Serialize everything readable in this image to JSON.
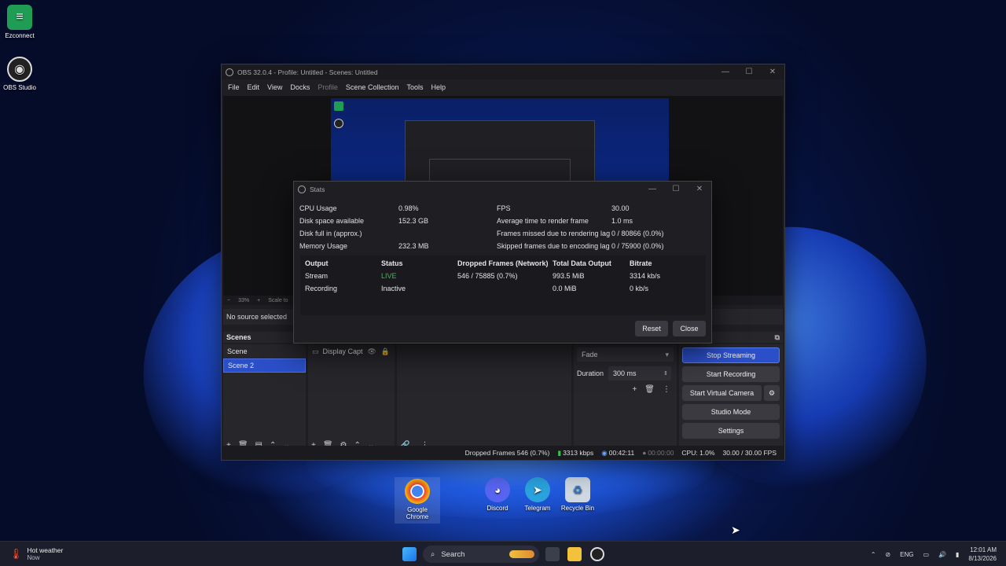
{
  "desktop": {
    "icons": [
      {
        "label": "Ezconnect",
        "icon": "ezconnect-icon"
      },
      {
        "label": "OBS Studio",
        "icon": "obs-icon"
      }
    ],
    "bottom_icons": [
      {
        "label": "Google Chrome",
        "icon": "chrome-icon"
      },
      {
        "label": "Discord",
        "icon": "discord-icon"
      },
      {
        "label": "Telegram",
        "icon": "telegram-icon"
      },
      {
        "label": "Recycle Bin",
        "icon": "recycle-bin-icon"
      }
    ]
  },
  "obs": {
    "title": "OBS 32.0.4 - Profile: Untitled - Scenes: Untitled",
    "menu": [
      "File",
      "Edit",
      "View",
      "Docks",
      "Profile",
      "Scene Collection",
      "Tools",
      "Help"
    ],
    "zoom": "33%",
    "scale_label": "Scale to",
    "no_source": "No source selected",
    "scenes_title": "Scenes",
    "scenes": [
      "Scene",
      "Scene 2"
    ],
    "selected_scene": "Scene 2",
    "source": "Display Capt",
    "transition": "Fade",
    "duration_label": "Duration",
    "duration_value": "300 ms",
    "controls": {
      "stop_streaming": "Stop Streaming",
      "start_recording": "Start Recording",
      "start_virtual_camera": "Start Virtual Camera",
      "studio_mode": "Studio Mode",
      "settings": "Settings"
    },
    "status": {
      "dropped": "Dropped Frames 546 (0.7%)",
      "bitrate": "3313 kbps",
      "stream_time": "00:42:11",
      "rec_time": "00:00:00",
      "cpu": "CPU: 1.0%",
      "fps": "30.00 / 30.00 FPS"
    }
  },
  "stats": {
    "title": "Stats",
    "left": [
      {
        "label": "CPU Usage",
        "value": "0.98%"
      },
      {
        "label": "Disk space available",
        "value": "152.3 GB"
      },
      {
        "label": "Disk full in (approx.)",
        "value": ""
      },
      {
        "label": "Memory Usage",
        "value": "232.3 MB"
      }
    ],
    "right": [
      {
        "label": "FPS",
        "value": "30.00"
      },
      {
        "label": "Average time to render frame",
        "value": "1.0 ms"
      },
      {
        "label": "Frames missed due to rendering lag",
        "value": "0 / 80866 (0.0%)"
      },
      {
        "label": "Skipped frames due to encoding lag",
        "value": "0 / 75900 (0.0%)"
      }
    ],
    "table": {
      "headers": [
        "Output",
        "Status",
        "Dropped Frames (Network)",
        "Total Data Output",
        "Bitrate"
      ],
      "rows": [
        [
          "Stream",
          "LIVE",
          "546 / 75885 (0.7%)",
          "993.5 MiB",
          "3314 kb/s"
        ],
        [
          "Recording",
          "Inactive",
          "",
          "0.0 MiB",
          "0 kb/s"
        ]
      ]
    },
    "reset": "Reset",
    "close": "Close"
  },
  "taskbar": {
    "weather_title": "Hot weather",
    "weather_sub": "Now",
    "search": "Search",
    "lang": "ENG",
    "time": "12:01 AM",
    "date": "8/13/2026"
  }
}
